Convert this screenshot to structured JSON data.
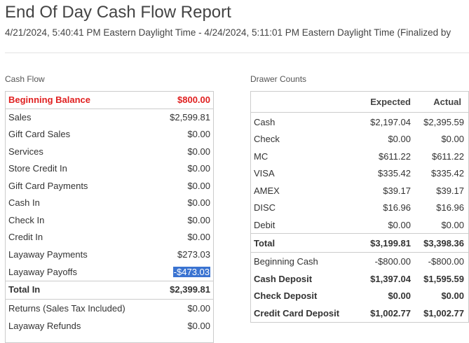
{
  "page": {
    "title": "End Of Day Cash Flow Report",
    "subtitle": "4/21/2024, 5:40:41 PM Eastern Daylight Time - 4/24/2024, 5:11:01 PM Eastern Daylight Time (Finalized by"
  },
  "cash_flow": {
    "label": "Cash Flow",
    "beginning_balance": {
      "label": "Beginning Balance",
      "value": "$800.00"
    },
    "rows": [
      {
        "label": "Sales",
        "value": "$2,599.81"
      },
      {
        "label": "Gift Card Sales",
        "value": "$0.00"
      },
      {
        "label": "Services",
        "value": "$0.00"
      },
      {
        "label": "Store Credit In",
        "value": "$0.00"
      },
      {
        "label": "Gift Card Payments",
        "value": "$0.00"
      },
      {
        "label": "Cash In",
        "value": "$0.00"
      },
      {
        "label": "Check In",
        "value": "$0.00"
      },
      {
        "label": "Credit In",
        "value": "$0.00"
      },
      {
        "label": "Layaway Payments",
        "value": "$273.03"
      },
      {
        "label": "Layaway Payoffs",
        "value": "-$473.03"
      }
    ],
    "total_in": {
      "label": "Total In",
      "value": "$2,399.81"
    },
    "rows_out": [
      {
        "label": "Returns (Sales Tax Included)",
        "value": "$0.00"
      },
      {
        "label": "Layaway Refunds",
        "value": "$0.00"
      }
    ]
  },
  "drawer_counts": {
    "label": "Drawer Counts",
    "headers": {
      "expected": "Expected",
      "actual": "Actual"
    },
    "rows": [
      {
        "label": "Cash",
        "expected": "$2,197.04",
        "actual": "$2,395.59"
      },
      {
        "label": "Check",
        "expected": "$0.00",
        "actual": "$0.00"
      },
      {
        "label": "MC",
        "expected": "$611.22",
        "actual": "$611.22"
      },
      {
        "label": "VISA",
        "expected": "$335.42",
        "actual": "$335.42"
      },
      {
        "label": "AMEX",
        "expected": "$39.17",
        "actual": "$39.17"
      },
      {
        "label": "DISC",
        "expected": "$16.96",
        "actual": "$16.96"
      },
      {
        "label": "Debit",
        "expected": "$0.00",
        "actual": "$0.00"
      }
    ],
    "total": {
      "label": "Total",
      "expected": "$3,199.81",
      "actual": "$3,398.36"
    },
    "deposit_rows": [
      {
        "label": "Beginning Cash",
        "expected": "-$800.00",
        "actual": "-$800.00",
        "bold": false
      },
      {
        "label": "Cash Deposit",
        "expected": "$1,397.04",
        "actual": "$1,595.59",
        "bold": true
      },
      {
        "label": "Check Deposit",
        "expected": "$0.00",
        "actual": "$0.00",
        "bold": true
      },
      {
        "label": "Credit Card Deposit",
        "expected": "$1,002.77",
        "actual": "$1,002.77",
        "bold": true
      }
    ]
  },
  "colors": {
    "beginning_balance": "#e02020",
    "selection_highlight": "#3a73d1",
    "border": "#cccccc"
  }
}
